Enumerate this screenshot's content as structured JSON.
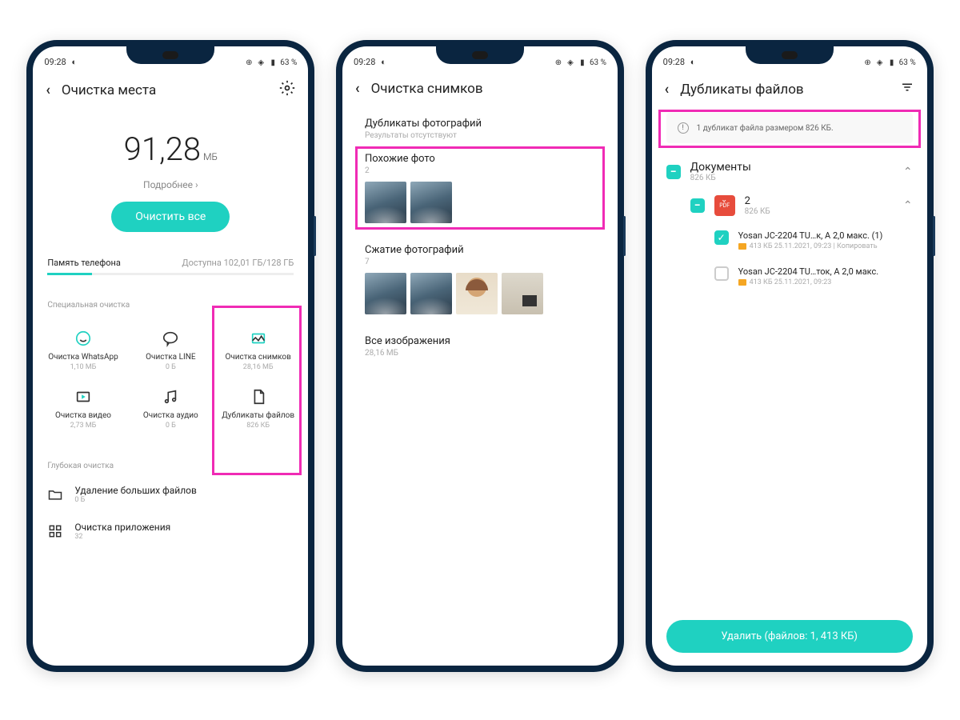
{
  "status": {
    "time": "09:28",
    "battery": "63 %"
  },
  "screen1": {
    "title": "Очистка места",
    "big_number": "91,28",
    "big_unit": "МБ",
    "details": "Подробнее",
    "clean_btn": "Очистить все",
    "storage_label": "Память телефона",
    "storage_avail": "Доступна 102,01 ГБ/128 ГБ",
    "special_title": "Специальная очистка",
    "grid": [
      {
        "label": "Очистка WhatsApp",
        "sub": "1,10 МБ"
      },
      {
        "label": "Очистка LINE",
        "sub": "0 Б"
      },
      {
        "label": "Очистка снимков",
        "sub": "28,16 МБ"
      },
      {
        "label": "Очистка видео",
        "sub": "2,73 МБ"
      },
      {
        "label": "Очистка аудио",
        "sub": "0 Б"
      },
      {
        "label": "Дубликаты файлов",
        "sub": "826 КБ"
      }
    ],
    "deep_title": "Глубокая очистка",
    "deep_items": [
      {
        "label": "Удаление больших файлов",
        "sub": "0 Б"
      },
      {
        "label": "Очистка приложения",
        "sub": "32"
      }
    ]
  },
  "screen2": {
    "title": "Очистка снимков",
    "sections": [
      {
        "title": "Дубликаты фотографий",
        "sub": "Результаты отсутствуют"
      },
      {
        "title": "Похожие фото",
        "sub": "2"
      },
      {
        "title": "Сжатие фотографий",
        "sub": "7"
      },
      {
        "title": "Все изображения",
        "sub": "28,16 МБ"
      }
    ]
  },
  "screen3": {
    "title": "Дубликаты файлов",
    "banner": "1 дубликат файла размером 826 КБ.",
    "group": {
      "title": "Документы",
      "sub": "826 КБ"
    },
    "subgroup": {
      "title": "2",
      "sub": "826 КБ"
    },
    "files": [
      {
        "name": "Yosan JC-2204 TU…к, А 2,0 макс. (1)",
        "meta": "413 КБ 25.11.2021, 09:23  |  Копировать",
        "checked": true
      },
      {
        "name": "Yosan JC-2204 TU…ток, А 2,0 макс.",
        "meta": "413 КБ 25.11.2021, 09:23",
        "checked": false
      }
    ],
    "delete_btn": "Удалить (файлов: 1, 413 КБ)"
  }
}
